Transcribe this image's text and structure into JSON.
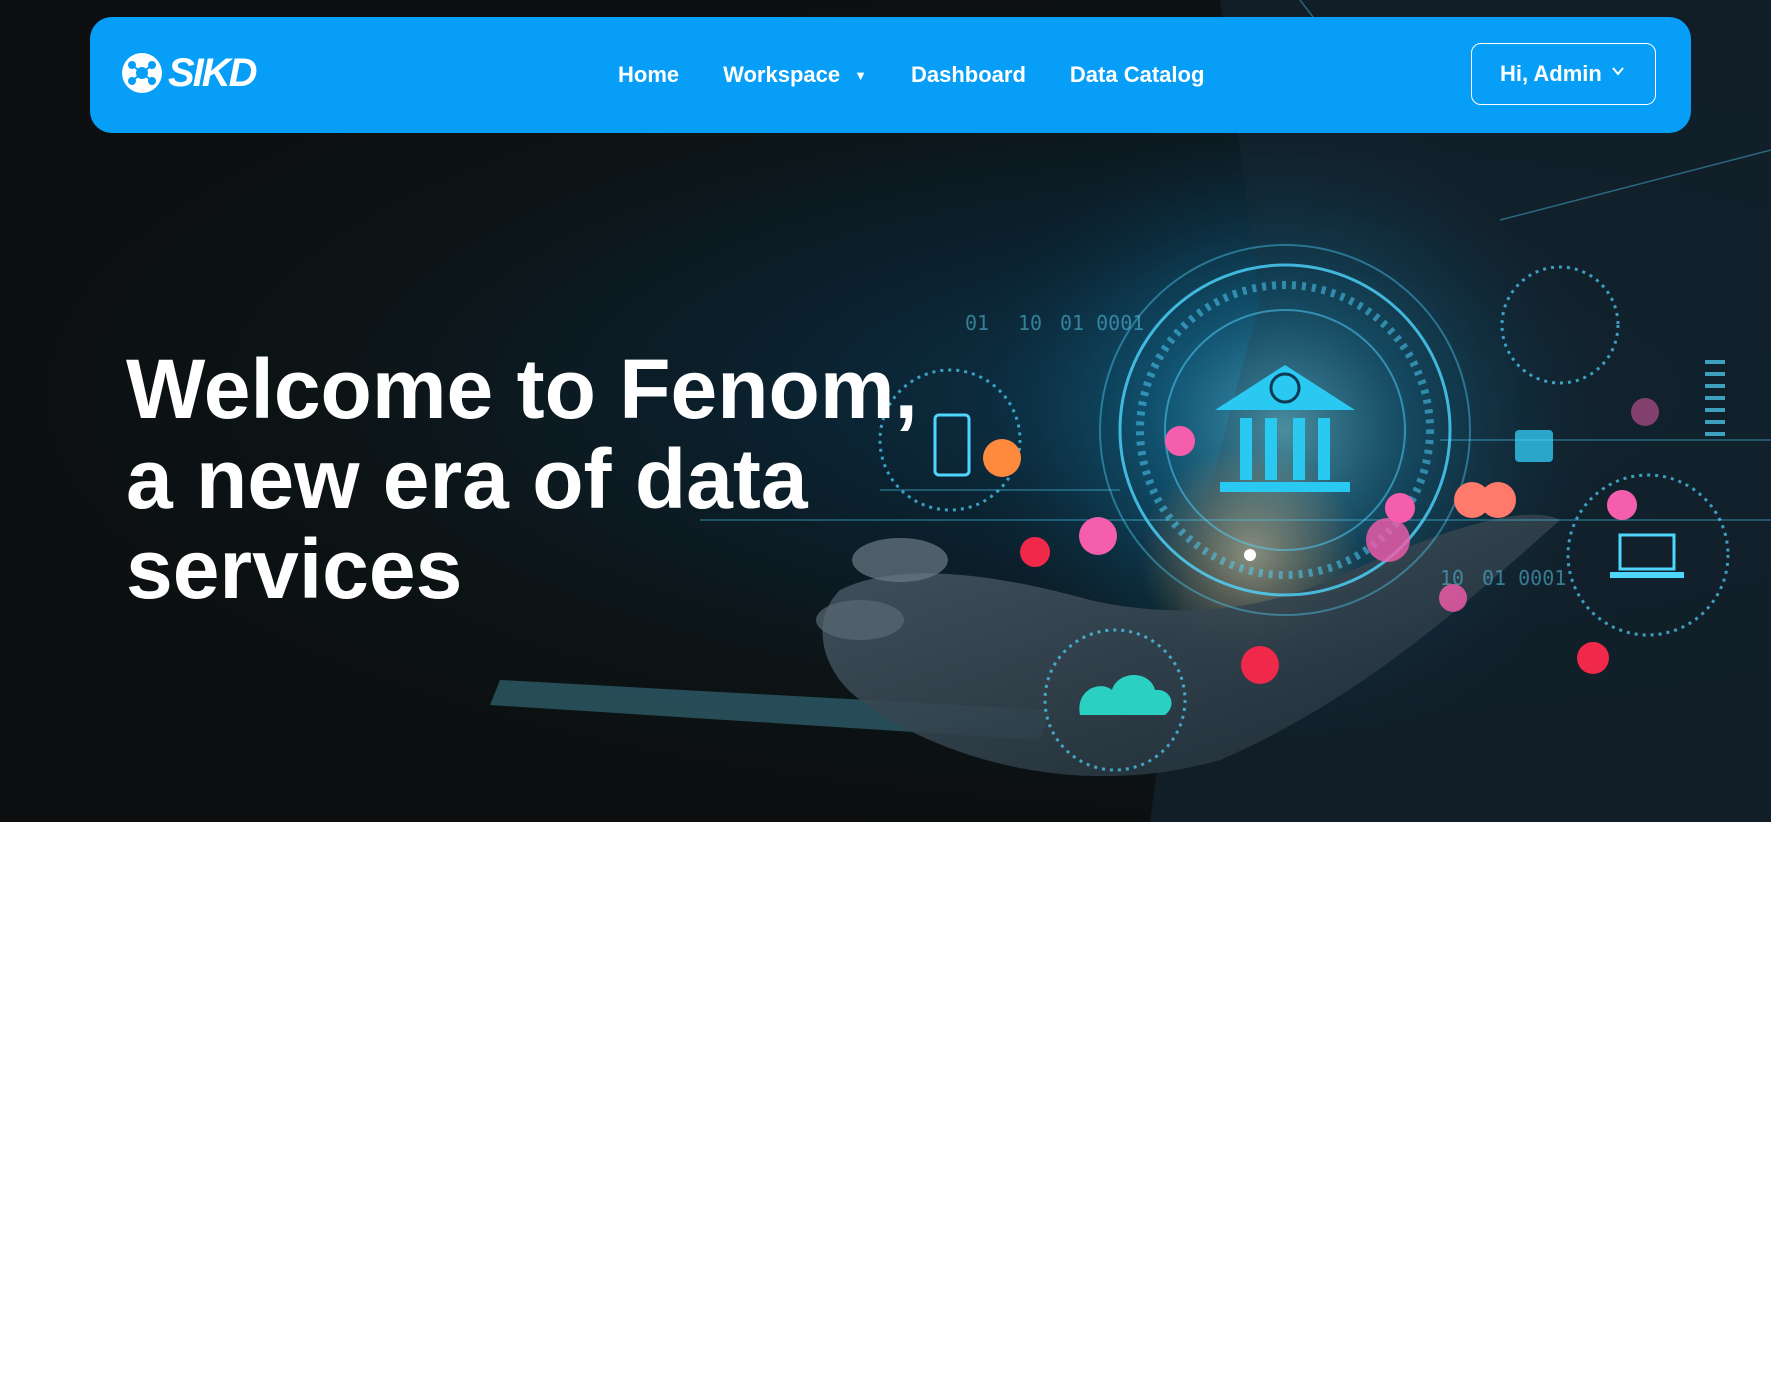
{
  "header": {
    "logo_text": "SIKD",
    "nav": [
      {
        "label": "Home"
      },
      {
        "label": "Workspace",
        "has_dropdown": true
      },
      {
        "label": "Dashboard"
      },
      {
        "label": "Data Catalog"
      }
    ],
    "user_menu_label": "Hi, Admin",
    "accent_color": "#069ef7"
  },
  "hero": {
    "headline_lines": [
      "Welcome to Fenom,",
      "a new era of data",
      "services"
    ],
    "background_image": "hand holding glowing digital network hologram with bank icon"
  }
}
